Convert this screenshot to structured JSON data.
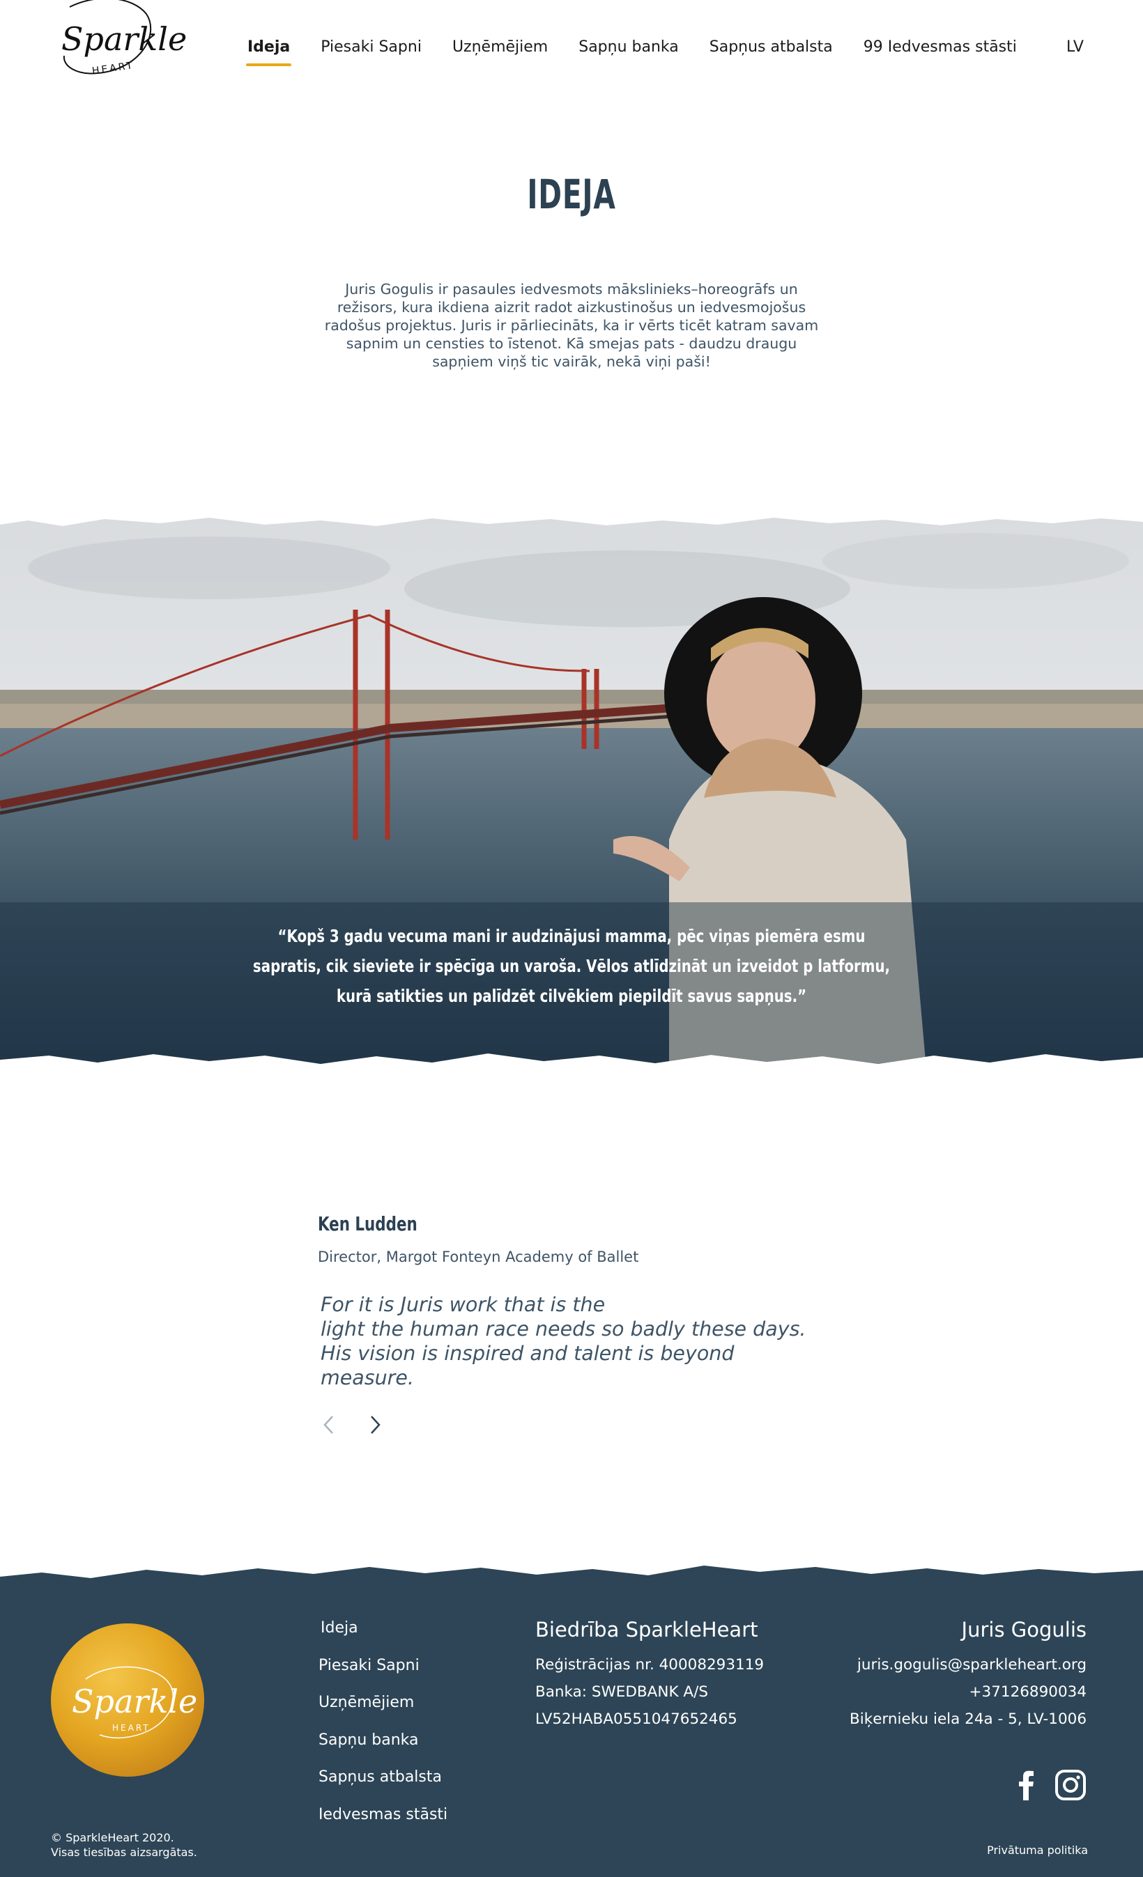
{
  "header": {
    "logo_text": "Sparkle",
    "logo_subtext": "HEART",
    "nav": [
      {
        "label": "Ideja"
      },
      {
        "label": "Piesaki Sapni"
      },
      {
        "label": "Uzņēmējiem"
      },
      {
        "label": "Sapņu banka"
      },
      {
        "label": "Sapņus atbalsta"
      },
      {
        "label": "99 Iedvesmas stāsti"
      }
    ],
    "lang": "LV",
    "accent_color": "#e8a817"
  },
  "idea": {
    "title": "IDEJA",
    "text": "Juris Gogulis ir pasaules iedvesmots mākslinieks–horeogrāfs un režisors, kura ikdiena aizrit radot aizkustinošus un iedvesmojošus radošus projektus. Juris ir pārliecināts, ka ir vērts ticēt katram savam sapnim un censties to īstenot. Kā smejas pats - daudzu draugu sapņiem viņš tic vairāk, nekā viņi paši!"
  },
  "hero": {
    "quote": "“Kopš 3 gadu vecuma mani ir audzinājusi mamma, pēc viņas piemēra esmu sapratis, cik sieviete ir spēcīga un varoša. Vēlos atlīdzināt un izveidot p latformu, kurā satikties un palīdzēt cilvēkiem piepildīt savus sapņus.”"
  },
  "testimonial": {
    "name": "Ken Ludden",
    "role": "Director, Margot Fonteyn Academy of Ballet",
    "quote": "For it is Juris work that is the\nlight the human race needs so badly these days.\nHis vision is inspired and talent is beyond\nmeasure."
  },
  "footer": {
    "bg_color": "#2d4556",
    "logo_text": "Sparkle",
    "logo_subtext": "HEART",
    "nav": [
      {
        "label": "Ideja"
      },
      {
        "label": "Piesaki Sapni"
      },
      {
        "label": "Uzņēmējiem"
      },
      {
        "label": "Sapņu banka"
      },
      {
        "label": "Sapņus atbalsta"
      },
      {
        "label": "Iedvesmas stāsti"
      }
    ],
    "org": {
      "title": "Biedrība SparkleHeart",
      "reg": "Reģistrācijas nr. 40008293119",
      "bank": "Banka: SWEDBANK A/S",
      "iban": "LV52HABA0551047652465"
    },
    "contact": {
      "name": "Juris Gogulis",
      "email": "juris.gogulis@sparkleheart.org",
      "phone": "+37126890034",
      "address": "Biķernieku iela 24a - 5, LV-1006"
    },
    "copyright_line1": "© SparkleHeart 2020.",
    "copyright_line2": "Visas tiesības aizsargātas.",
    "privacy": "Privātuma politika"
  }
}
